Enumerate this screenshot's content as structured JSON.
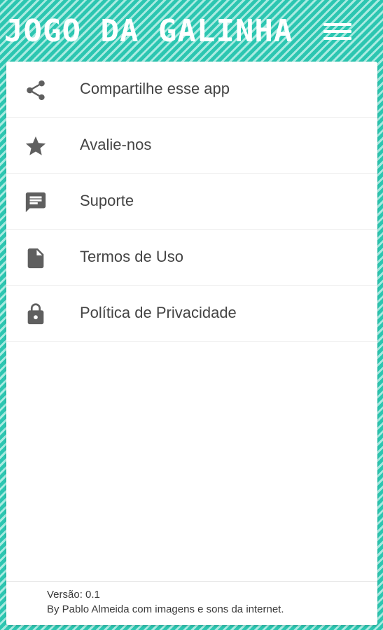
{
  "header": {
    "title": "JOGO DA GALINHA",
    "menu_icon": "hamburger-menu-icon"
  },
  "colors": {
    "background_stripe_dark": "#2cc6b1",
    "background_stripe_light": "#a9ebe1",
    "icon_gray": "#5f5f5f",
    "text_gray": "#444444"
  },
  "menu": {
    "items": [
      {
        "label": "Compartilhe esse app",
        "icon": "share-icon"
      },
      {
        "label": "Avalie-nos",
        "icon": "star-icon"
      },
      {
        "label": "Suporte",
        "icon": "chat-icon"
      },
      {
        "label": "Termos de Uso",
        "icon": "document-icon"
      },
      {
        "label": "Política de Privacidade",
        "icon": "lock-icon"
      }
    ]
  },
  "footer": {
    "version": "Versão: 0.1",
    "credits": "By Pablo Almeida com imagens e sons da internet."
  }
}
